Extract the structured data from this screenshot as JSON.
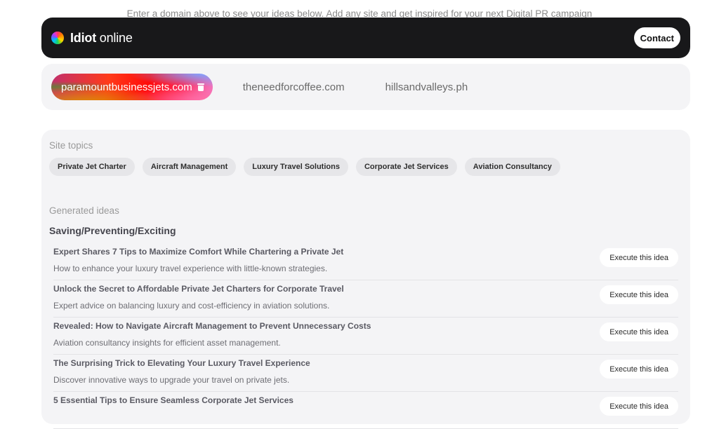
{
  "hint": "Enter a domain above to see your ideas below. Add any site and get inspired for your next Digital PR campaign",
  "navbar": {
    "logo_icon": "multicolor-flower-logo",
    "brand_bold": "Idiot",
    "brand_light": " online",
    "contact_label": "Contact"
  },
  "domains": {
    "items": [
      {
        "label": "paramountbusinessjets.com",
        "active": true,
        "icon": "trash-icon"
      },
      {
        "label": "theneedforcoffee.com",
        "active": false
      },
      {
        "label": "hillsandvalleys.ph",
        "active": false
      }
    ]
  },
  "site_topics": {
    "label": "Site topics",
    "items": [
      "Private Jet Charter",
      "Aircraft Management",
      "Luxury Travel Solutions",
      "Corporate Jet Services",
      "Aviation Consultancy"
    ]
  },
  "generated": {
    "label": "Generated ideas",
    "category": "Saving/Preventing/Exciting",
    "execute_label": "Execute this idea",
    "ideas": [
      {
        "title": "Expert Shares 7 Tips to Maximize Comfort While Chartering a Private Jet",
        "desc": "How to enhance your luxury travel experience with little-known strategies."
      },
      {
        "title": "Unlock the Secret to Affordable Private Jet Charters for Corporate Travel",
        "desc": "Expert advice on balancing luxury and cost-efficiency in aviation solutions."
      },
      {
        "title": "Revealed: How to Navigate Aircraft Management to Prevent Unnecessary Costs",
        "desc": "Aviation consultancy insights for efficient asset management."
      },
      {
        "title": "The Surprising Trick to Elevating Your Luxury Travel Experience",
        "desc": "Discover innovative ways to upgrade your travel on private jets."
      },
      {
        "title": "5 Essential Tips to Ensure Seamless Corporate Jet Services",
        "desc": ""
      }
    ]
  }
}
